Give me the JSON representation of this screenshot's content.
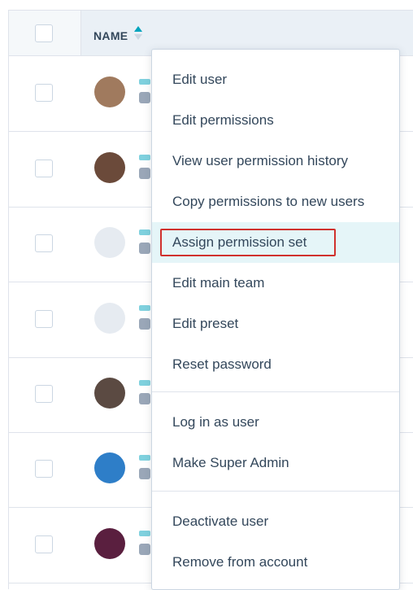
{
  "table": {
    "name_header": "NAME",
    "rows": [
      {
        "avatar_color": "#a07a5e"
      },
      {
        "avatar_color": "#6b4a3a"
      },
      {
        "avatar_color": "#e6ebf1"
      },
      {
        "avatar_color": "#e6ebf1"
      },
      {
        "avatar_color": "#5b4a42"
      },
      {
        "avatar_color": "#2e7ec8"
      },
      {
        "avatar_color": "#5a1f3f"
      }
    ]
  },
  "menu": {
    "items": [
      {
        "label": "Edit user"
      },
      {
        "label": "Edit permissions"
      },
      {
        "label": "View user permission history"
      },
      {
        "label": "Copy permissions to new users"
      },
      {
        "label": "Assign permission set",
        "highlighted": true
      },
      {
        "label": "Edit main team"
      },
      {
        "label": "Edit preset"
      },
      {
        "label": "Reset password"
      },
      {
        "label": "Log in as user"
      },
      {
        "label": "Make Super Admin"
      },
      {
        "label": "Deactivate user"
      },
      {
        "label": "Remove from account"
      }
    ]
  },
  "colors": {
    "accent": "#00a4bd",
    "highlight_bg": "#e5f5f8",
    "annotation_red": "#d0312d",
    "text": "#33475b"
  }
}
